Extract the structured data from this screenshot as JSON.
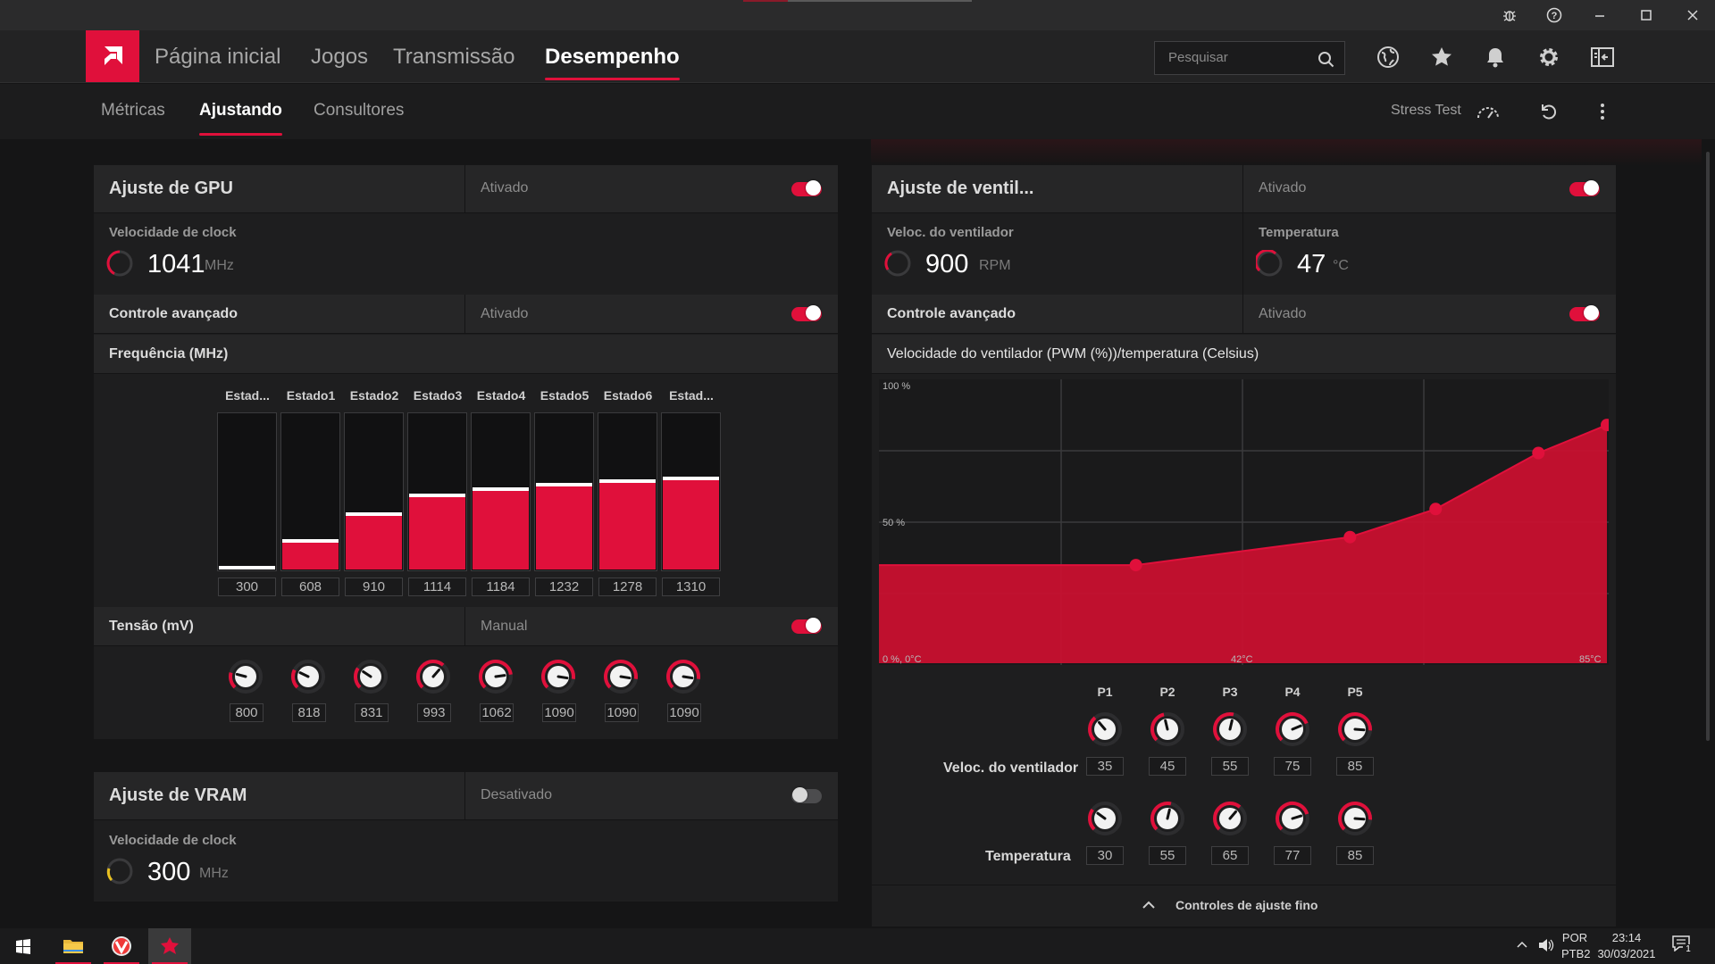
{
  "window": {
    "controls": [
      "bug-report",
      "help",
      "minimize",
      "maximize",
      "close"
    ]
  },
  "nav": {
    "items": [
      "Página inicial",
      "Jogos",
      "Transmissão",
      "Desempenho"
    ],
    "active": "Desempenho",
    "search_placeholder": "Pesquisar"
  },
  "subnav": {
    "items": [
      "Métricas",
      "Ajustando",
      "Consultores"
    ],
    "active": "Ajustando",
    "stress_test": "Stress Test"
  },
  "gpu": {
    "title": "Ajuste de GPU",
    "status": "Ativado",
    "clock_label": "Velocidade de clock",
    "clock_value": "1041",
    "clock_unit": "MHz",
    "advanced_label": "Controle avançado",
    "advanced_status": "Ativado",
    "freq_label": "Frequência (MHz)",
    "states": [
      "Estad...",
      "Estado1",
      "Estado2",
      "Estado3",
      "Estado4",
      "Estado5",
      "Estado6",
      "Estad..."
    ],
    "frequencies": [
      "300",
      "608",
      "910",
      "1114",
      "1184",
      "1232",
      "1278",
      "1310"
    ],
    "freq_fill": [
      0.0,
      0.17,
      0.34,
      0.46,
      0.5,
      0.53,
      0.55,
      0.57
    ],
    "voltage_label": "Tensão (mV)",
    "voltage_mode": "Manual",
    "voltages": [
      "800",
      "818",
      "831",
      "993",
      "1062",
      "1090",
      "1090",
      "1090"
    ]
  },
  "vram": {
    "title": "Ajuste de VRAM",
    "status": "Desativado",
    "clock_label": "Velocidade de clock",
    "clock_value": "300",
    "clock_unit": "MHz"
  },
  "fan": {
    "title": "Ajuste de ventil...",
    "status": "Ativado",
    "speed_label": "Veloc. do ventilador",
    "speed_value": "900",
    "speed_unit": "RPM",
    "temp_label": "Temperatura",
    "temp_value": "47",
    "temp_unit": "°C",
    "advanced_label": "Controle avançado",
    "advanced_status": "Ativado",
    "curve_title": "Velocidade do ventilador (PWM (%))/temperatura (Celsius)",
    "axis": {
      "y_top": "100 %",
      "y_mid": "50 %",
      "origin": "0 %, 0°C",
      "x_mid": "42°C",
      "x_max": "85°C"
    },
    "points": [
      "P1",
      "P2",
      "P3",
      "P4",
      "P5"
    ],
    "speed_row_label": "Veloc. do ventilador",
    "speed_values": [
      "35",
      "45",
      "55",
      "75",
      "85"
    ],
    "temp_row_label": "Temperatura",
    "temp_values": [
      "30",
      "55",
      "65",
      "77",
      "85"
    ],
    "fine_tune": "Controles de ajuste fino"
  },
  "chart_data": {
    "type": "area",
    "title": "Velocidade do ventilador (PWM (%))/temperatura (Celsius)",
    "xlabel": "",
    "ylabel": "",
    "xlim": [
      0,
      85
    ],
    "ylim": [
      0,
      100
    ],
    "x": [
      0,
      30,
      55,
      65,
      77,
      85
    ],
    "series": [
      {
        "values": [
          35,
          35,
          45,
          55,
          75,
          85
        ]
      }
    ],
    "grid": true
  },
  "taskbar": {
    "lang": "POR",
    "layout": "PTB2",
    "time": "23:14",
    "date": "30/03/2021",
    "notifications": "1"
  },
  "colors": {
    "accent": "#e0103b",
    "panel": "#1e1e1f",
    "header": "#262627"
  }
}
